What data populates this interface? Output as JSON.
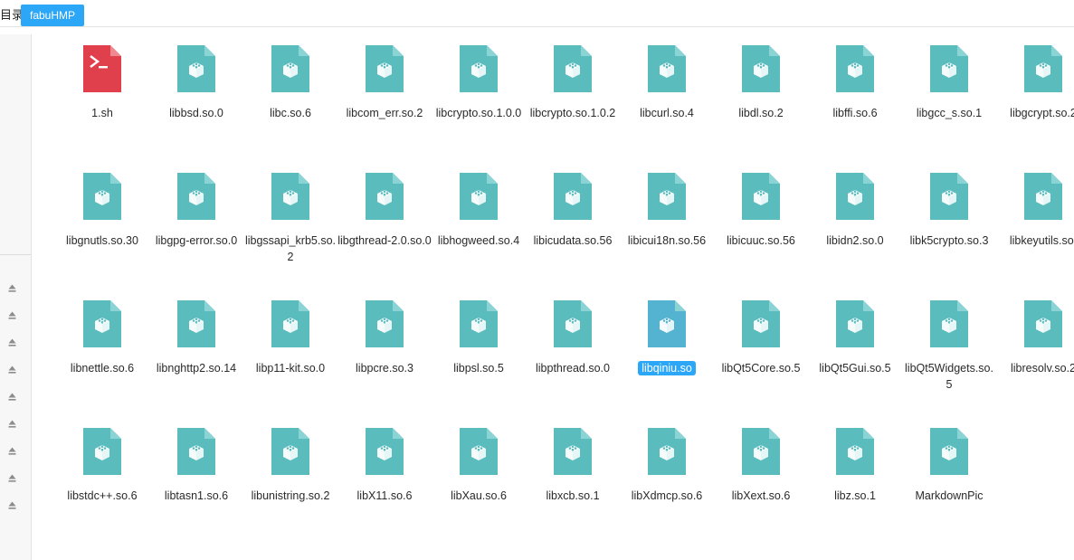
{
  "breadcrumb": {
    "root_label": "目录",
    "active_label": "fabuHMP"
  },
  "colors": {
    "accent": "#2ca7f8",
    "lib_icon": "#5bbcbe",
    "lib_icon_fold": "#8ad4d5",
    "script_icon": "#e0404b",
    "selected_icon": "#55b3d2"
  },
  "files": [
    {
      "name": "1.sh",
      "type": "script"
    },
    {
      "name": "libbsd.so.0",
      "type": "library"
    },
    {
      "name": "libc.so.6",
      "type": "library"
    },
    {
      "name": "libcom_err.so.2",
      "type": "library"
    },
    {
      "name": "libcrypto.so.1.0.0",
      "type": "library"
    },
    {
      "name": "libcrypto.so.1.0.2",
      "type": "library"
    },
    {
      "name": "libcurl.so.4",
      "type": "library"
    },
    {
      "name": "libdl.so.2",
      "type": "library"
    },
    {
      "name": "libffi.so.6",
      "type": "library"
    },
    {
      "name": "libgcc_s.so.1",
      "type": "library"
    },
    {
      "name": "libgcrypt.so.2",
      "type": "library"
    },
    {
      "name": "libgnutls.so.30",
      "type": "library"
    },
    {
      "name": "libgpg-error.so.0",
      "type": "library"
    },
    {
      "name": "libgssapi_krb5.so.2",
      "type": "library"
    },
    {
      "name": "libgthread-2.0.so.0",
      "type": "library"
    },
    {
      "name": "libhogweed.so.4",
      "type": "library"
    },
    {
      "name": "libicudata.so.56",
      "type": "library"
    },
    {
      "name": "libicui18n.so.56",
      "type": "library"
    },
    {
      "name": "libicuuc.so.56",
      "type": "library"
    },
    {
      "name": "libidn2.so.0",
      "type": "library"
    },
    {
      "name": "libk5crypto.so.3",
      "type": "library"
    },
    {
      "name": "libkeyutils.so.",
      "type": "library"
    },
    {
      "name": "libnettle.so.6",
      "type": "library"
    },
    {
      "name": "libnghttp2.so.14",
      "type": "library"
    },
    {
      "name": "libp11-kit.so.0",
      "type": "library"
    },
    {
      "name": "libpcre.so.3",
      "type": "library"
    },
    {
      "name": "libpsl.so.5",
      "type": "library"
    },
    {
      "name": "libpthread.so.0",
      "type": "library"
    },
    {
      "name": "libqiniu.so",
      "type": "library",
      "selected": true
    },
    {
      "name": "libQt5Core.so.5",
      "type": "library"
    },
    {
      "name": "libQt5Gui.so.5",
      "type": "library"
    },
    {
      "name": "libQt5Widgets.so.5",
      "type": "library"
    },
    {
      "name": "libresolv.so.2",
      "type": "library"
    },
    {
      "name": "libstdc++.so.6",
      "type": "library"
    },
    {
      "name": "libtasn1.so.6",
      "type": "library"
    },
    {
      "name": "libunistring.so.2",
      "type": "library"
    },
    {
      "name": "libX11.so.6",
      "type": "library"
    },
    {
      "name": "libXau.so.6",
      "type": "library"
    },
    {
      "name": "libxcb.so.1",
      "type": "library"
    },
    {
      "name": "libXdmcp.so.6",
      "type": "library"
    },
    {
      "name": "libXext.so.6",
      "type": "library"
    },
    {
      "name": "libz.so.1",
      "type": "library"
    },
    {
      "name": "MarkdownPic",
      "type": "library"
    }
  ],
  "sidebar": {
    "eject_icons": [
      "eject-icon",
      "eject-icon",
      "eject-icon",
      "eject-icon",
      "eject-icon",
      "eject-icon",
      "eject-icon",
      "eject-icon",
      "eject-icon"
    ]
  }
}
